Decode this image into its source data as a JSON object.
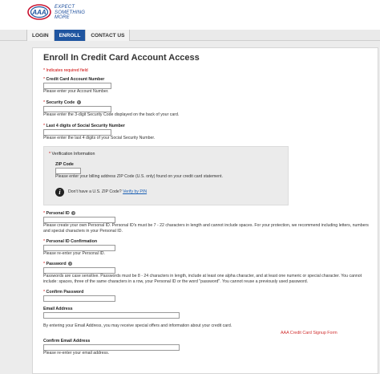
{
  "header": {
    "logo_text": "AAA",
    "tagline_lines": [
      "EXPECT",
      "SOMETHING",
      "MORE"
    ]
  },
  "nav": {
    "items": [
      "LOGIN",
      "ENROLL",
      "CONTACT US"
    ],
    "active_index": 1
  },
  "form": {
    "title": "Enroll In Credit Card Account Access",
    "required_note": "* Indicates required field",
    "account_number": {
      "label": "Credit Card Account Number",
      "help": "Please enter your Account Number."
    },
    "security_code": {
      "label": "Security Code",
      "help": "Please enter the 3-digit Security Code displayed on the back of your card."
    },
    "ssn": {
      "label": "Last 4 digits of Social Security Number",
      "help": "Please enter the last 4 digits of your Social Security Number."
    },
    "verification": {
      "title": "Verification Information",
      "zip_label": "ZIP Code",
      "zip_help": "Please enter your billing address ZIP Code (U.S. only) found on your credit card statement.",
      "no_zip_text": "Don't have a U.S. ZIP Code?",
      "verify_link": "Verify by PIN"
    },
    "personal_id": {
      "label": "Personal ID",
      "help": "Please create your own Personal ID.  Personal ID's must be 7 - 22 characters in length and cannot include spaces.  For your protection, we recommend including letters, numbers and special characters in your Personal ID."
    },
    "personal_id_confirm": {
      "label": "Personal ID Confirmation",
      "help": "Please re-enter your Personal ID."
    },
    "password": {
      "label": "Password",
      "help": "Passwords are case sensitive. Passwords must be 8 - 24 characters in length, include at least one alpha character, and at least one numeric or special character.  You cannot include: spaces, three of the same characters in a row, your Personal ID or the word \"password\". You cannot reuse a previously used password."
    },
    "confirm_password": {
      "label": "Confirm Password"
    },
    "email": {
      "label": "Email Address",
      "help": "By entering your Email Address, you may receive special offers and information about your credit card."
    },
    "confirm_email": {
      "label": "Confirm Email Address",
      "help": "Please re-enter your email address."
    },
    "required_mark": "*",
    "help_icon_glyph": "?"
  },
  "watermark": "AAA Credit Card Signup Form",
  "colors": {
    "brand_blue": "#1f55a0",
    "required_red": "#cc0000",
    "link_blue": "#1a5fb4"
  },
  "icons": {
    "logo": "aaa-logo-icon",
    "help": "question-circle-icon",
    "info": "info-circle-icon"
  }
}
